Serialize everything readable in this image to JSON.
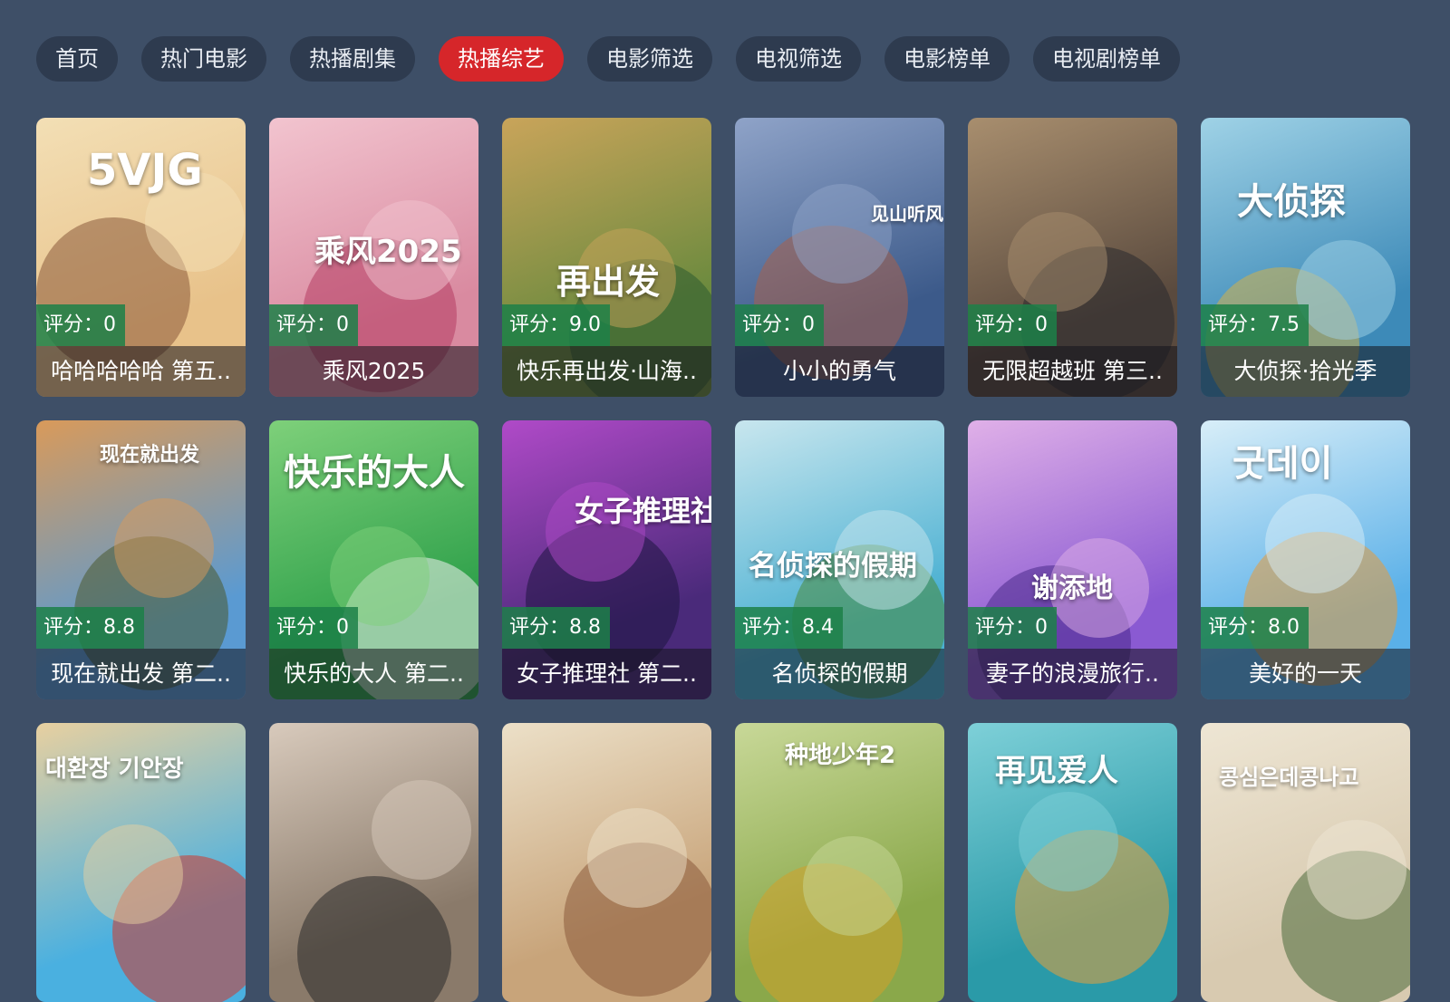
{
  "nav": {
    "tabs": [
      "首页",
      "热门电影",
      "热播剧集",
      "热播综艺",
      "电影筛选",
      "电视筛选",
      "电影榜单",
      "电视剧榜单"
    ],
    "active_index": 3
  },
  "colors": {
    "background": "#3e4f67",
    "tab_background": "#2e3b4f",
    "tab_active": "#d6262a",
    "rating_badge": "#1c8048"
  },
  "cards": [
    {
      "title": "哈哈哈哈哈 第五..",
      "rating": "评分：0",
      "poster_text": "5VJG",
      "bg": "#e8c28a",
      "bg2": "#f3dfb5",
      "accent": "#8a5a3a"
    },
    {
      "title": "乘风2025",
      "rating": "评分：0",
      "poster_text": "乘风2025",
      "bg": "#d98aa0",
      "bg2": "#f2c4cf",
      "accent": "#b53d63"
    },
    {
      "title": "快乐再出发·山海..",
      "rating": "评分：9.0",
      "poster_text": "再出发",
      "bg": "#6b8a3e",
      "bg2": "#c9a45a",
      "accent": "#2e5b2f"
    },
    {
      "title": "小小的勇气",
      "rating": "评分：0",
      "poster_text": "见山听风",
      "bg": "#3c5a8a",
      "bg2": "#8fa3c8",
      "accent": "#a8604a"
    },
    {
      "title": "无限超越班 第三..",
      "rating": "评分：0",
      "poster_text": "",
      "bg": "#5a4a3e",
      "bg2": "#a88e6e",
      "accent": "#2a2a2e"
    },
    {
      "title": "大侦探·拾光季",
      "rating": "评分：7.5",
      "poster_text": "大侦探",
      "bg": "#3d8ab8",
      "bg2": "#9fd2e6",
      "accent": "#d2b04a"
    },
    {
      "title": "现在就出发 第二..",
      "rating": "评分：8.8",
      "poster_text": "现在就出发",
      "bg": "#5a9ad2",
      "bg2": "#d99a5a",
      "accent": "#4a5a2e"
    },
    {
      "title": "快乐的大人 第二..",
      "rating": "评分：0",
      "poster_text": "快乐的大人",
      "bg": "#2ea04a",
      "bg2": "#7ed07a",
      "accent": "#f0f0f0"
    },
    {
      "title": "女子推理社 第二..",
      "rating": "评分：8.8",
      "poster_text": "女子推理社",
      "bg": "#4a2a7a",
      "bg2": "#b04ac8",
      "accent": "#1e1440"
    },
    {
      "title": "名侦探的假期",
      "rating": "评分：8.4",
      "poster_text": "名侦探的假期",
      "bg": "#4ab0d2",
      "bg2": "#c8e6ee",
      "accent": "#4a8a3a"
    },
    {
      "title": "妻子的浪漫旅行..",
      "rating": "评分：0",
      "poster_text": "谢添地",
      "bg": "#8a5ad2",
      "bg2": "#e0b0e8",
      "accent": "#4a2a8a"
    },
    {
      "title": "美好的一天",
      "rating": "评分：8.0",
      "poster_text": "굿데이",
      "bg": "#5ab0e8",
      "bg2": "#d8eef8",
      "accent": "#e89a3a"
    },
    {
      "title": "",
      "rating": "",
      "poster_text": "대환장 기안장",
      "bg": "#4ab0e0",
      "bg2": "#e8d0a0",
      "accent": "#d2362a"
    },
    {
      "title": "",
      "rating": "",
      "poster_text": "",
      "bg": "#8a7a6a",
      "bg2": "#d8cabc",
      "accent": "#2a2a2a"
    },
    {
      "title": "",
      "rating": "",
      "poster_text": "",
      "bg": "#c8a47a",
      "bg2": "#ece0c8",
      "accent": "#8a5a3a"
    },
    {
      "title": "",
      "rating": "",
      "poster_text": "种地少年2",
      "bg": "#8aa84a",
      "bg2": "#c8d898",
      "accent": "#d2a02a"
    },
    {
      "title": "",
      "rating": "",
      "poster_text": "再见爱人",
      "bg": "#2a9aa8",
      "bg2": "#7ed0d8",
      "accent": "#e8a03a"
    },
    {
      "title": "",
      "rating": "",
      "poster_text": "콩심은데콩나고",
      "bg": "#d8cab0",
      "bg2": "#eee6d4",
      "accent": "#4a6a3a"
    }
  ]
}
